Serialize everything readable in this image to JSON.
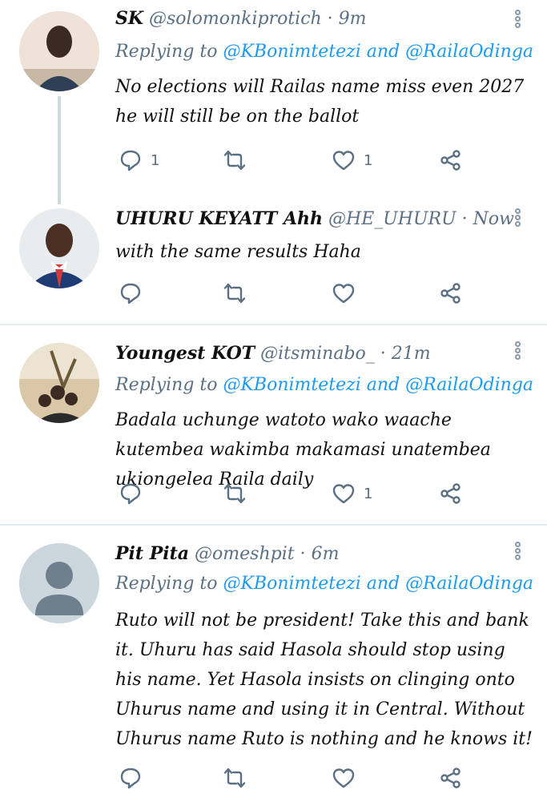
{
  "tweets": [
    {
      "name": "SK",
      "handle": "@solomonkiprotich",
      "time": "9m",
      "replying_prefix": "Replying to ",
      "mention1": "@KBonimtetezi",
      "conj": " and ",
      "mention2": "@RailaOdinga",
      "body": "No elections will Railas name miss even 2027 he will still be on the ballot",
      "reply_count": "1",
      "retweet_count": "",
      "like_count": "1"
    },
    {
      "name": "UHURU KEYATT Ahh",
      "handle": "@HE_UHURU",
      "time": "Now",
      "body": "with the same results Haha",
      "reply_count": "",
      "retweet_count": "",
      "like_count": ""
    },
    {
      "name": "Youngest KOT",
      "handle": "@itsminabo_",
      "time": "21m",
      "replying_prefix": "Replying to ",
      "mention1": "@KBonimtetezi",
      "conj": " and ",
      "mention2": "@RailaOdinga",
      "body": "Badala uchunge watoto wako waache kutembea wakimba makamasi unatembea ukiongelea Raila daily",
      "reply_count": "",
      "retweet_count": "",
      "like_count": "1"
    },
    {
      "name": "Pit Pita",
      "handle": "@omeshpit",
      "time": "6m",
      "replying_prefix": "Replying to ",
      "mention1": "@KBonimtetezi",
      "conj": " and ",
      "mention2": "@RailaOdinga",
      "body": "Ruto will not be president! Take this and bank it. Uhuru has said Hasola should stop using his name. Yet Hasola insists on clinging onto Uhurus name and using it in Central. Without Uhurus name Ruto is nothing and he knows it!",
      "reply_count": "",
      "retweet_count": "",
      "like_count": ""
    }
  ],
  "separator": " · ",
  "icons": [
    "reply-icon",
    "retweet-icon",
    "like-icon",
    "share-icon",
    "more-options-icon"
  ],
  "colors": {
    "link": "#1d9bf0",
    "secondary": "#5b7083",
    "thread_line": "#cfd9de",
    "divider": "#e6ecf0"
  }
}
